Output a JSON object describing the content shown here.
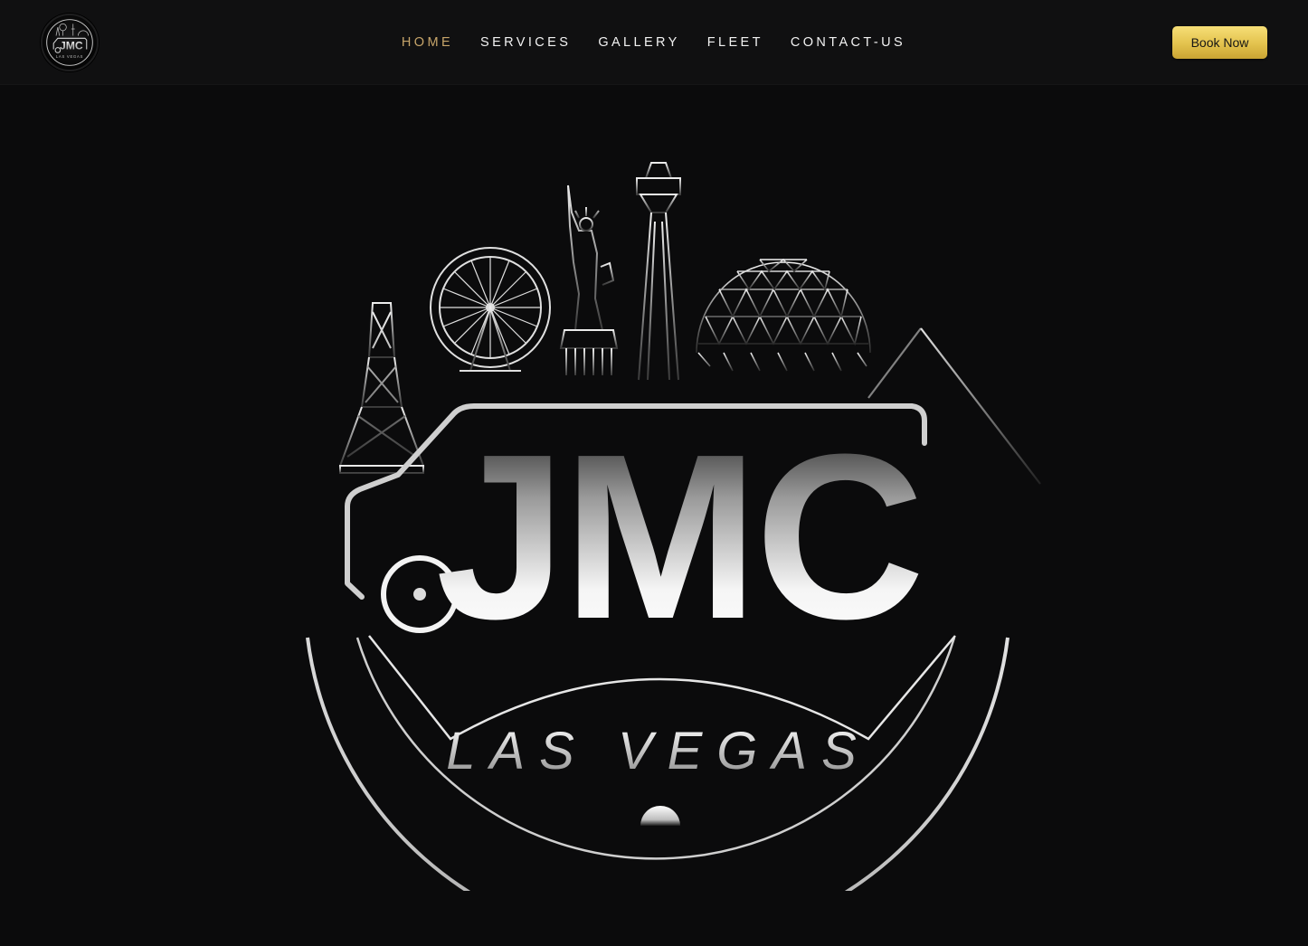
{
  "header": {
    "logo": {
      "icon": "jmc-las-vegas-logo-icon",
      "wordmark": "JMC",
      "subtitle": "LAS VEGAS"
    },
    "nav": [
      {
        "label": "HOME",
        "active": true
      },
      {
        "label": "SERVICES",
        "active": false
      },
      {
        "label": "GALLERY",
        "active": false
      },
      {
        "label": "FLEET",
        "active": false
      },
      {
        "label": "CONTACT-US",
        "active": false
      }
    ],
    "cta_label": "Book Now"
  },
  "hero": {
    "emblem": {
      "icon": "jmc-las-vegas-emblem-icon",
      "wordmark": "JMC",
      "subtitle": "LAS VEGAS"
    }
  },
  "colors": {
    "background": "#0b0b0c",
    "navbar": "#101011",
    "nav_text": "#f2f2f2",
    "nav_active": "#c7a56a",
    "cta_gold": "#e3c24d"
  }
}
